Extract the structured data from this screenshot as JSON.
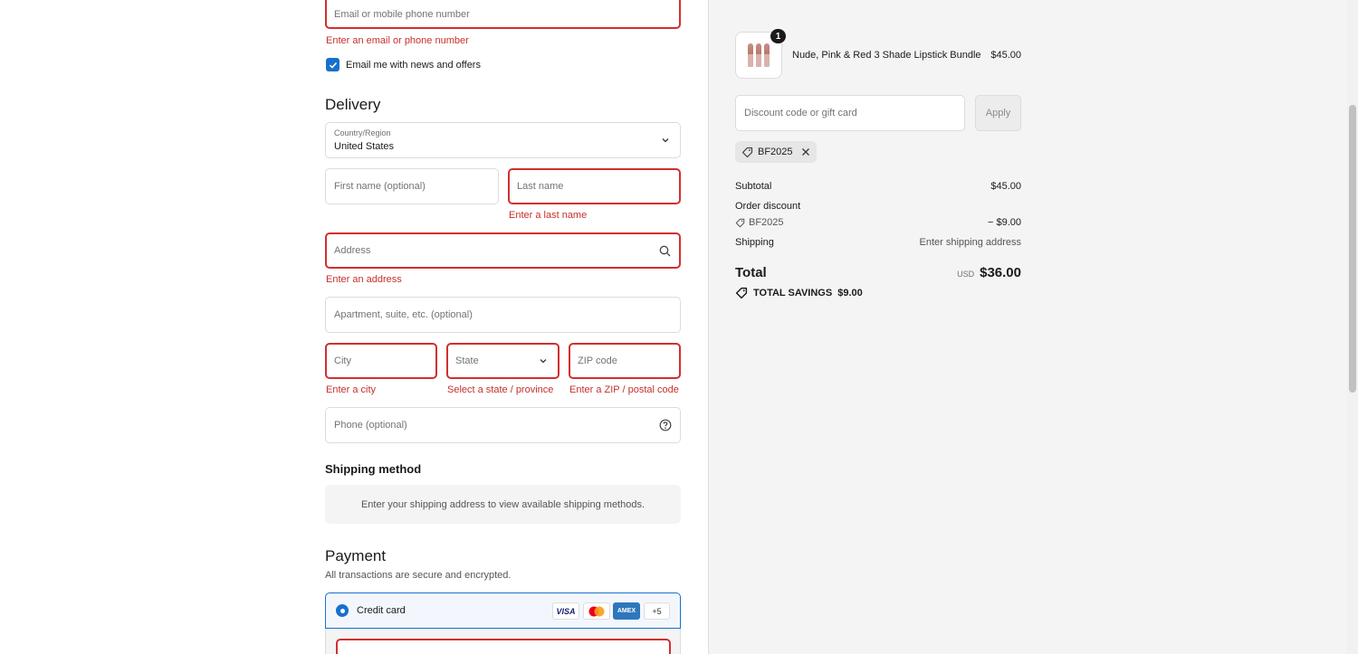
{
  "contact": {
    "email_placeholder": "Email or mobile phone number",
    "email_error": "Enter an email or phone number",
    "newsletter_label": "Email me with news and offers",
    "newsletter_checked": true
  },
  "delivery": {
    "heading": "Delivery",
    "country_label": "Country/Region",
    "country_value": "United States",
    "first_name_placeholder": "First name (optional)",
    "last_name_placeholder": "Last name",
    "last_name_error": "Enter a last name",
    "address_placeholder": "Address",
    "address_error": "Enter an address",
    "apartment_placeholder": "Apartment, suite, etc. (optional)",
    "city_placeholder": "City",
    "city_error": "Enter a city",
    "state_placeholder": "State",
    "state_error": "Select a state / province",
    "zip_placeholder": "ZIP code",
    "zip_error": "Enter a ZIP / postal code",
    "phone_placeholder": "Phone (optional)"
  },
  "shipping_method": {
    "heading": "Shipping method",
    "message": "Enter your shipping address to view available shipping methods."
  },
  "payment": {
    "heading": "Payment",
    "subtext": "All transactions are secure and encrypted.",
    "option_label": "Credit card",
    "card_logos": [
      "VISA",
      "Mastercard",
      "AMEX"
    ],
    "more_cards": "+5",
    "colors": {
      "accent": "#1870cc",
      "error": "#d0302e",
      "mastercard_red": "#eb001b",
      "mastercard_yellow": "#f79e1b",
      "amex_blue": "#2e77bc"
    }
  },
  "summary": {
    "product": {
      "quantity": "1",
      "name": "Nude, Pink & Red 3 Shade Lipstick Bundle",
      "price": "$45.00"
    },
    "discount_placeholder": "Discount code or gift card",
    "apply_label": "Apply",
    "applied_code": "BF2025",
    "subtotal_label": "Subtotal",
    "subtotal_value": "$45.00",
    "order_discount_label": "Order discount",
    "discount_code": "BF2025",
    "discount_value": "− $9.00",
    "shipping_label": "Shipping",
    "shipping_value": "Enter shipping address",
    "total_label": "Total",
    "currency": "USD",
    "total_value": "$36.00",
    "savings_label": "TOTAL SAVINGS",
    "savings_value": "$9.00"
  }
}
